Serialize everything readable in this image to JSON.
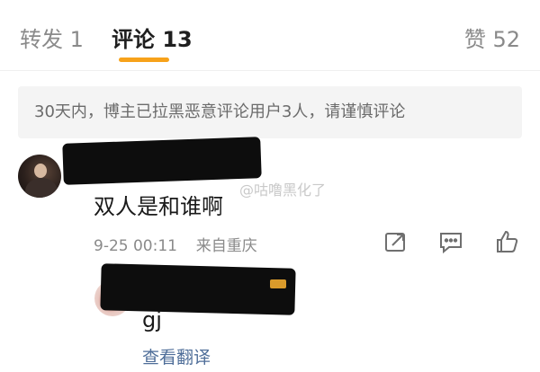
{
  "tabs": {
    "repost": "转发 1",
    "comments": "评论 13",
    "likes": "赞 52"
  },
  "notice": "30天内，博主已拉黑恶意评论用户3人，请谨慎评论",
  "comment": {
    "text": "双人是和谁啊",
    "time": "9-25 00:11",
    "location": "来自重庆",
    "icons": [
      "share-icon",
      "reply-icon",
      "like-icon"
    ]
  },
  "watermark": "@咕噜黑化了",
  "reply": {
    "text": "gj",
    "translate_label": "查看翻译"
  },
  "colors": {
    "tab_indicator": "#f7a21a",
    "translate_link": "#4f6e99",
    "notice_bg": "#f4f4f4",
    "redaction": "#0d0d0d"
  }
}
